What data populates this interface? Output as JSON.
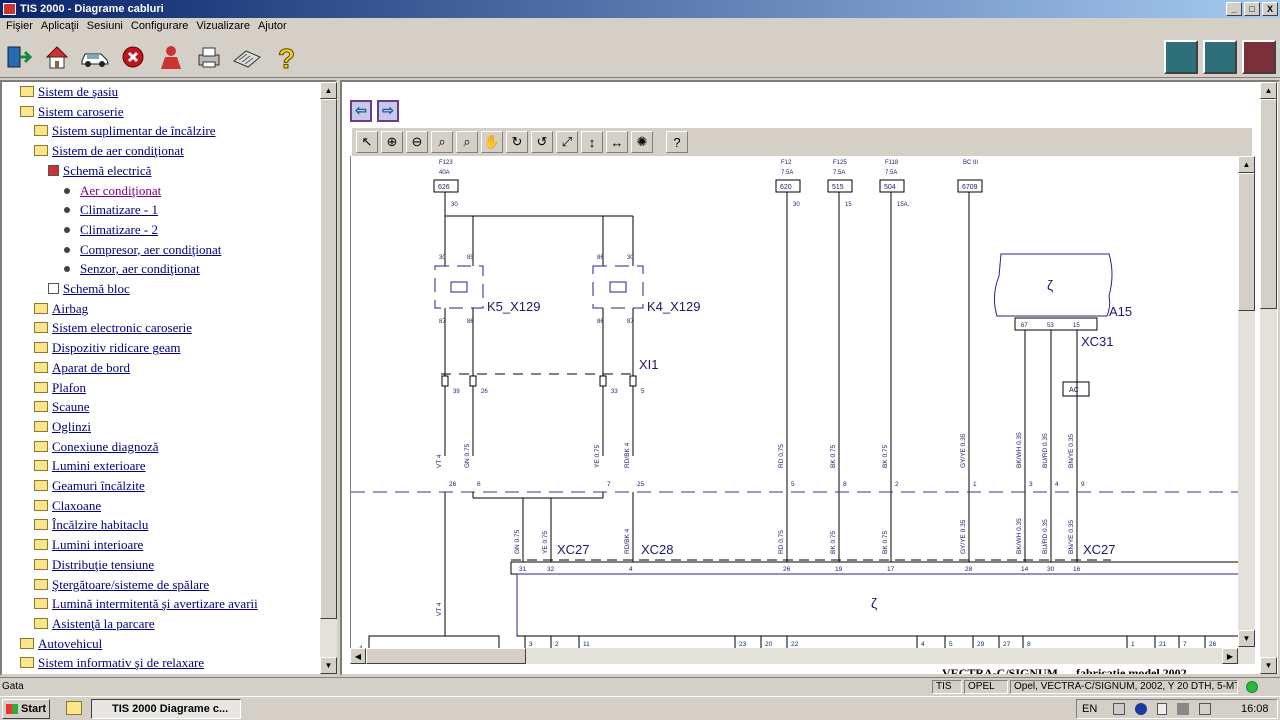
{
  "window": {
    "title": "TIS 2000 - Diagrame cabluri",
    "buttons": [
      "_",
      "□",
      "X"
    ]
  },
  "menu": [
    "Fişier",
    "Aplicaţii",
    "Sesiuni",
    "Configurare",
    "Vizualizare",
    "Ajutor"
  ],
  "toolbar": {
    "left_icons": [
      "exit-icon",
      "home-icon",
      "vehicle-icon",
      "stop-icon",
      "person-icon",
      "print-icon",
      "keyboard-icon",
      "help-icon"
    ],
    "right_icons": [
      "module-1-icon",
      "module-2-icon",
      "module-3-icon"
    ]
  },
  "tree": [
    {
      "label": "Sistem de şasiu",
      "level": 0,
      "type": "folder"
    },
    {
      "label": "Sistem caroserie",
      "level": 0,
      "type": "folder"
    },
    {
      "label": "Sistem suplimentar de încălzire",
      "level": 1,
      "type": "folder"
    },
    {
      "label": "Sistem de aer condiţionat",
      "level": 1,
      "type": "folder"
    },
    {
      "label": "Schemă electrică",
      "level": 2,
      "type": "doc-red"
    },
    {
      "label": "Aer condiţionat",
      "level": 3,
      "type": "bullet",
      "selected": true
    },
    {
      "label": "Climatizare - 1",
      "level": 3,
      "type": "bullet"
    },
    {
      "label": "Climatizare - 2",
      "level": 3,
      "type": "bullet"
    },
    {
      "label": "Compresor, aer condiţionat",
      "level": 3,
      "type": "bullet"
    },
    {
      "label": "Senzor, aer condiţionat",
      "level": 3,
      "type": "bullet"
    },
    {
      "label": "Schemă bloc",
      "level": 2,
      "type": "doc"
    },
    {
      "label": "Airbag",
      "level": 1,
      "type": "folder"
    },
    {
      "label": "Sistem electronic caroserie",
      "level": 1,
      "type": "folder"
    },
    {
      "label": "Dispozitiv ridicare geam",
      "level": 1,
      "type": "folder"
    },
    {
      "label": "Aparat de bord",
      "level": 1,
      "type": "folder"
    },
    {
      "label": "Plafon",
      "level": 1,
      "type": "folder"
    },
    {
      "label": "Scaune",
      "level": 1,
      "type": "folder"
    },
    {
      "label": "Oglinzi",
      "level": 1,
      "type": "folder"
    },
    {
      "label": "Conexiune diagnoză",
      "level": 1,
      "type": "folder"
    },
    {
      "label": "Lumini exterioare",
      "level": 1,
      "type": "folder"
    },
    {
      "label": "Geamuri încălzite",
      "level": 1,
      "type": "folder"
    },
    {
      "label": "Claxoane",
      "level": 1,
      "type": "folder"
    },
    {
      "label": "Încălzire habitaclu",
      "level": 1,
      "type": "folder"
    },
    {
      "label": "Lumini interioare",
      "level": 1,
      "type": "folder"
    },
    {
      "label": "Distribuţie tensiune",
      "level": 1,
      "type": "folder"
    },
    {
      "label": "Ştergătoare/sisteme de spălare",
      "level": 1,
      "type": "folder"
    },
    {
      "label": "Lumină intermitentă şi avertizare avarii",
      "level": 1,
      "type": "folder"
    },
    {
      "label": "Asistenţă la parcare",
      "level": 1,
      "type": "folder"
    },
    {
      "label": "Autovehicul",
      "level": 0,
      "type": "folder"
    },
    {
      "label": "Sistem informativ şi de relaxare",
      "level": 0,
      "type": "folder"
    }
  ],
  "diagram_toolbar": [
    "select-arrow-icon",
    "zoom-in-icon",
    "zoom-out-icon",
    "zoom-icon",
    "zoom-fit-icon",
    "pan-hand-icon",
    "rotate-cw-icon",
    "rotate-ccw-icon",
    "fit-page-icon",
    "fit-height-icon",
    "fit-width-icon",
    "highlight-icon",
    "help-icon"
  ],
  "diagram": {
    "fuses": [
      {
        "name": "F123",
        "rating": "40A",
        "code": "626",
        "pin": "30"
      },
      {
        "name": "F12",
        "rating": "7.5A",
        "code": "620",
        "pin": "30"
      },
      {
        "name": "F125",
        "rating": "7.5A",
        "code": "515",
        "pin": "15"
      },
      {
        "name": "F118",
        "rating": "7.5A",
        "code": "504",
        "pin": "15A."
      },
      {
        "name": "BC III",
        "rating": "",
        "code": "6709",
        "pin": ""
      }
    ],
    "relays": [
      {
        "name": "K5_X129",
        "pins": [
          "30",
          "85",
          "87",
          "86"
        ]
      },
      {
        "name": "K4_X129",
        "pins": [
          "86",
          "30",
          "86",
          "87"
        ]
      }
    ],
    "module_a15": {
      "name": "A15",
      "connector": "XC31",
      "pins": [
        "67",
        "53",
        "15"
      ],
      "ac": "AC"
    },
    "connector_xi1": {
      "name": "XI1",
      "pins": [
        "39",
        "26",
        "33",
        "5"
      ]
    },
    "wires_mid": [
      "VT 4",
      "GN 0.75",
      "YE 0.75",
      "RD/BK 4",
      "RD 0.75",
      "BK 0.75",
      "BK 0.75",
      "GY/YE 0.35",
      "BK/WH 0.35",
      "BU/RD 0.35",
      "BN/YE 0.35"
    ],
    "pins_mid": [
      "26",
      "6",
      "7",
      "25",
      "5",
      "8",
      "2",
      "1",
      "3",
      "4",
      "9"
    ],
    "wires_low": [
      "GN 0.75",
      "YE 0.75",
      "RD/BK 4",
      "RD 0.75",
      "BK 0.75",
      "BK 0.75",
      "GY/YE 0.35",
      "BK/WH 0.35",
      "BU/RD 0.35",
      "BN/YE 0.35"
    ],
    "connectors_low": [
      "XC27",
      "XC28",
      "XC27"
    ],
    "pins_low": [
      "31",
      "32",
      "4",
      "26",
      "19",
      "17",
      "28",
      "14",
      "30",
      "16"
    ],
    "bottom_pins": [
      "3",
      "2",
      "11",
      "23",
      "20",
      "22",
      "4",
      "5",
      "29",
      "27",
      "8",
      "1",
      "21",
      "7",
      "26"
    ],
    "vt4_low": "VT 4",
    "footer": "VECTRA-C/SIGNUM .... fabricaţie model 2002"
  },
  "status": {
    "left": "Gata",
    "cells": [
      "TIS",
      "OPEL",
      "Opel, VECTRA-C/SIGNUM, 2002, Y 20 DTH, 5-MT"
    ]
  },
  "taskbar": {
    "start": "Start",
    "task": "TIS 2000 Diagrame c...",
    "lang": "EN",
    "time": "16:08"
  }
}
